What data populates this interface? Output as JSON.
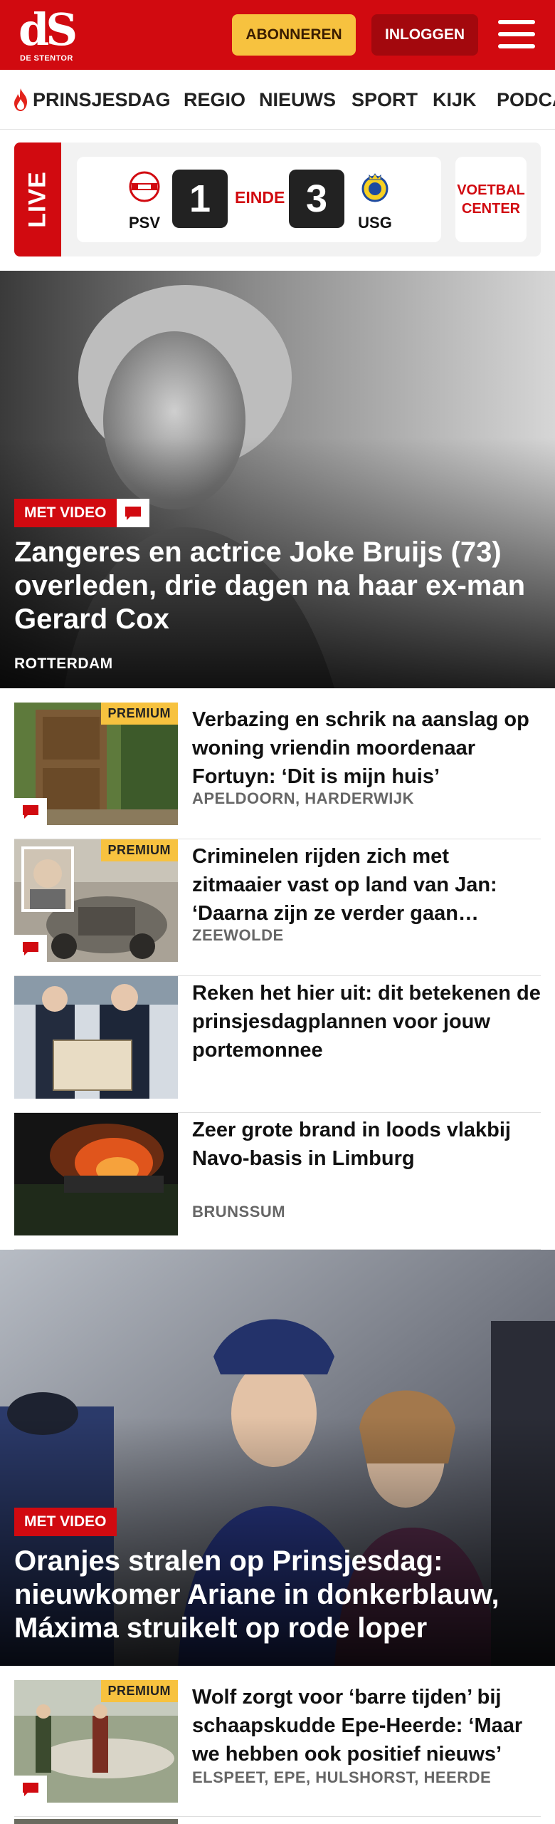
{
  "header": {
    "logo_mark": "dS",
    "logo_sub": "DE STENTOR",
    "subscribe_label": "ABONNEREN",
    "login_label": "INLOGGEN",
    "colors": {
      "brand_red": "#d10a10",
      "subscribe_yellow": "#f7c23f",
      "login_dark_red": "#a3080d"
    }
  },
  "nav": {
    "items": [
      {
        "label": "PRINSJESDAG",
        "icon": "flame-icon"
      },
      {
        "label": "REGIO"
      },
      {
        "label": "NIEUWS"
      },
      {
        "label": "SPORT"
      },
      {
        "label": "KIJK"
      },
      {
        "label": "PODCA"
      }
    ]
  },
  "live": {
    "tag": "LIVE",
    "home_team": "PSV",
    "home_score": "1",
    "status": "EINDE",
    "away_score": "3",
    "away_team": "USG",
    "voetbal_center": "VOETBAL CENTER"
  },
  "hero1": {
    "badge": "MET VIDEO",
    "title": "Zangeres en actrice Joke Bruijs (73) overleden, drie dagen na haar ex-man Gerard Cox",
    "location": "ROTTERDAM"
  },
  "articles": [
    {
      "premium": "PREMIUM",
      "title": "Verbazing en schrik na aanslag op woning vriendin moordenaar Fortuyn: ‘Dit is mijn huis’",
      "location": "APELDOORN, HARDERWIJK"
    },
    {
      "premium": "PREMIUM",
      "title": "Criminelen rijden zich met zitmaaier vast op land van Jan: ‘Daarna zijn ze verder gaan…",
      "location": "ZEEWOLDE"
    },
    {
      "title": "Reken het hier uit: dit betekenen de prinsjesdagplannen voor jouw portemonnee",
      "location": ""
    },
    {
      "title": "Zeer grote brand in loods vlakbij Navo-basis in Limburg",
      "location": "BRUNSSUM"
    }
  ],
  "hero2": {
    "badge": "MET VIDEO",
    "title": "Oranjes stralen op Prinsjesdag: nieuwkomer Ariane in donkerblauw, Máxima struikelt op rode loper"
  },
  "articles2": [
    {
      "premium": "PREMIUM",
      "title": "Wolf zorgt voor ‘barre tijden’ bij schaapskudde Epe-Heerde: ‘Maar we hebben ook positief nieuws’",
      "location": "ELSPEET, EPE, HULSHORST, HEERDE"
    }
  ]
}
